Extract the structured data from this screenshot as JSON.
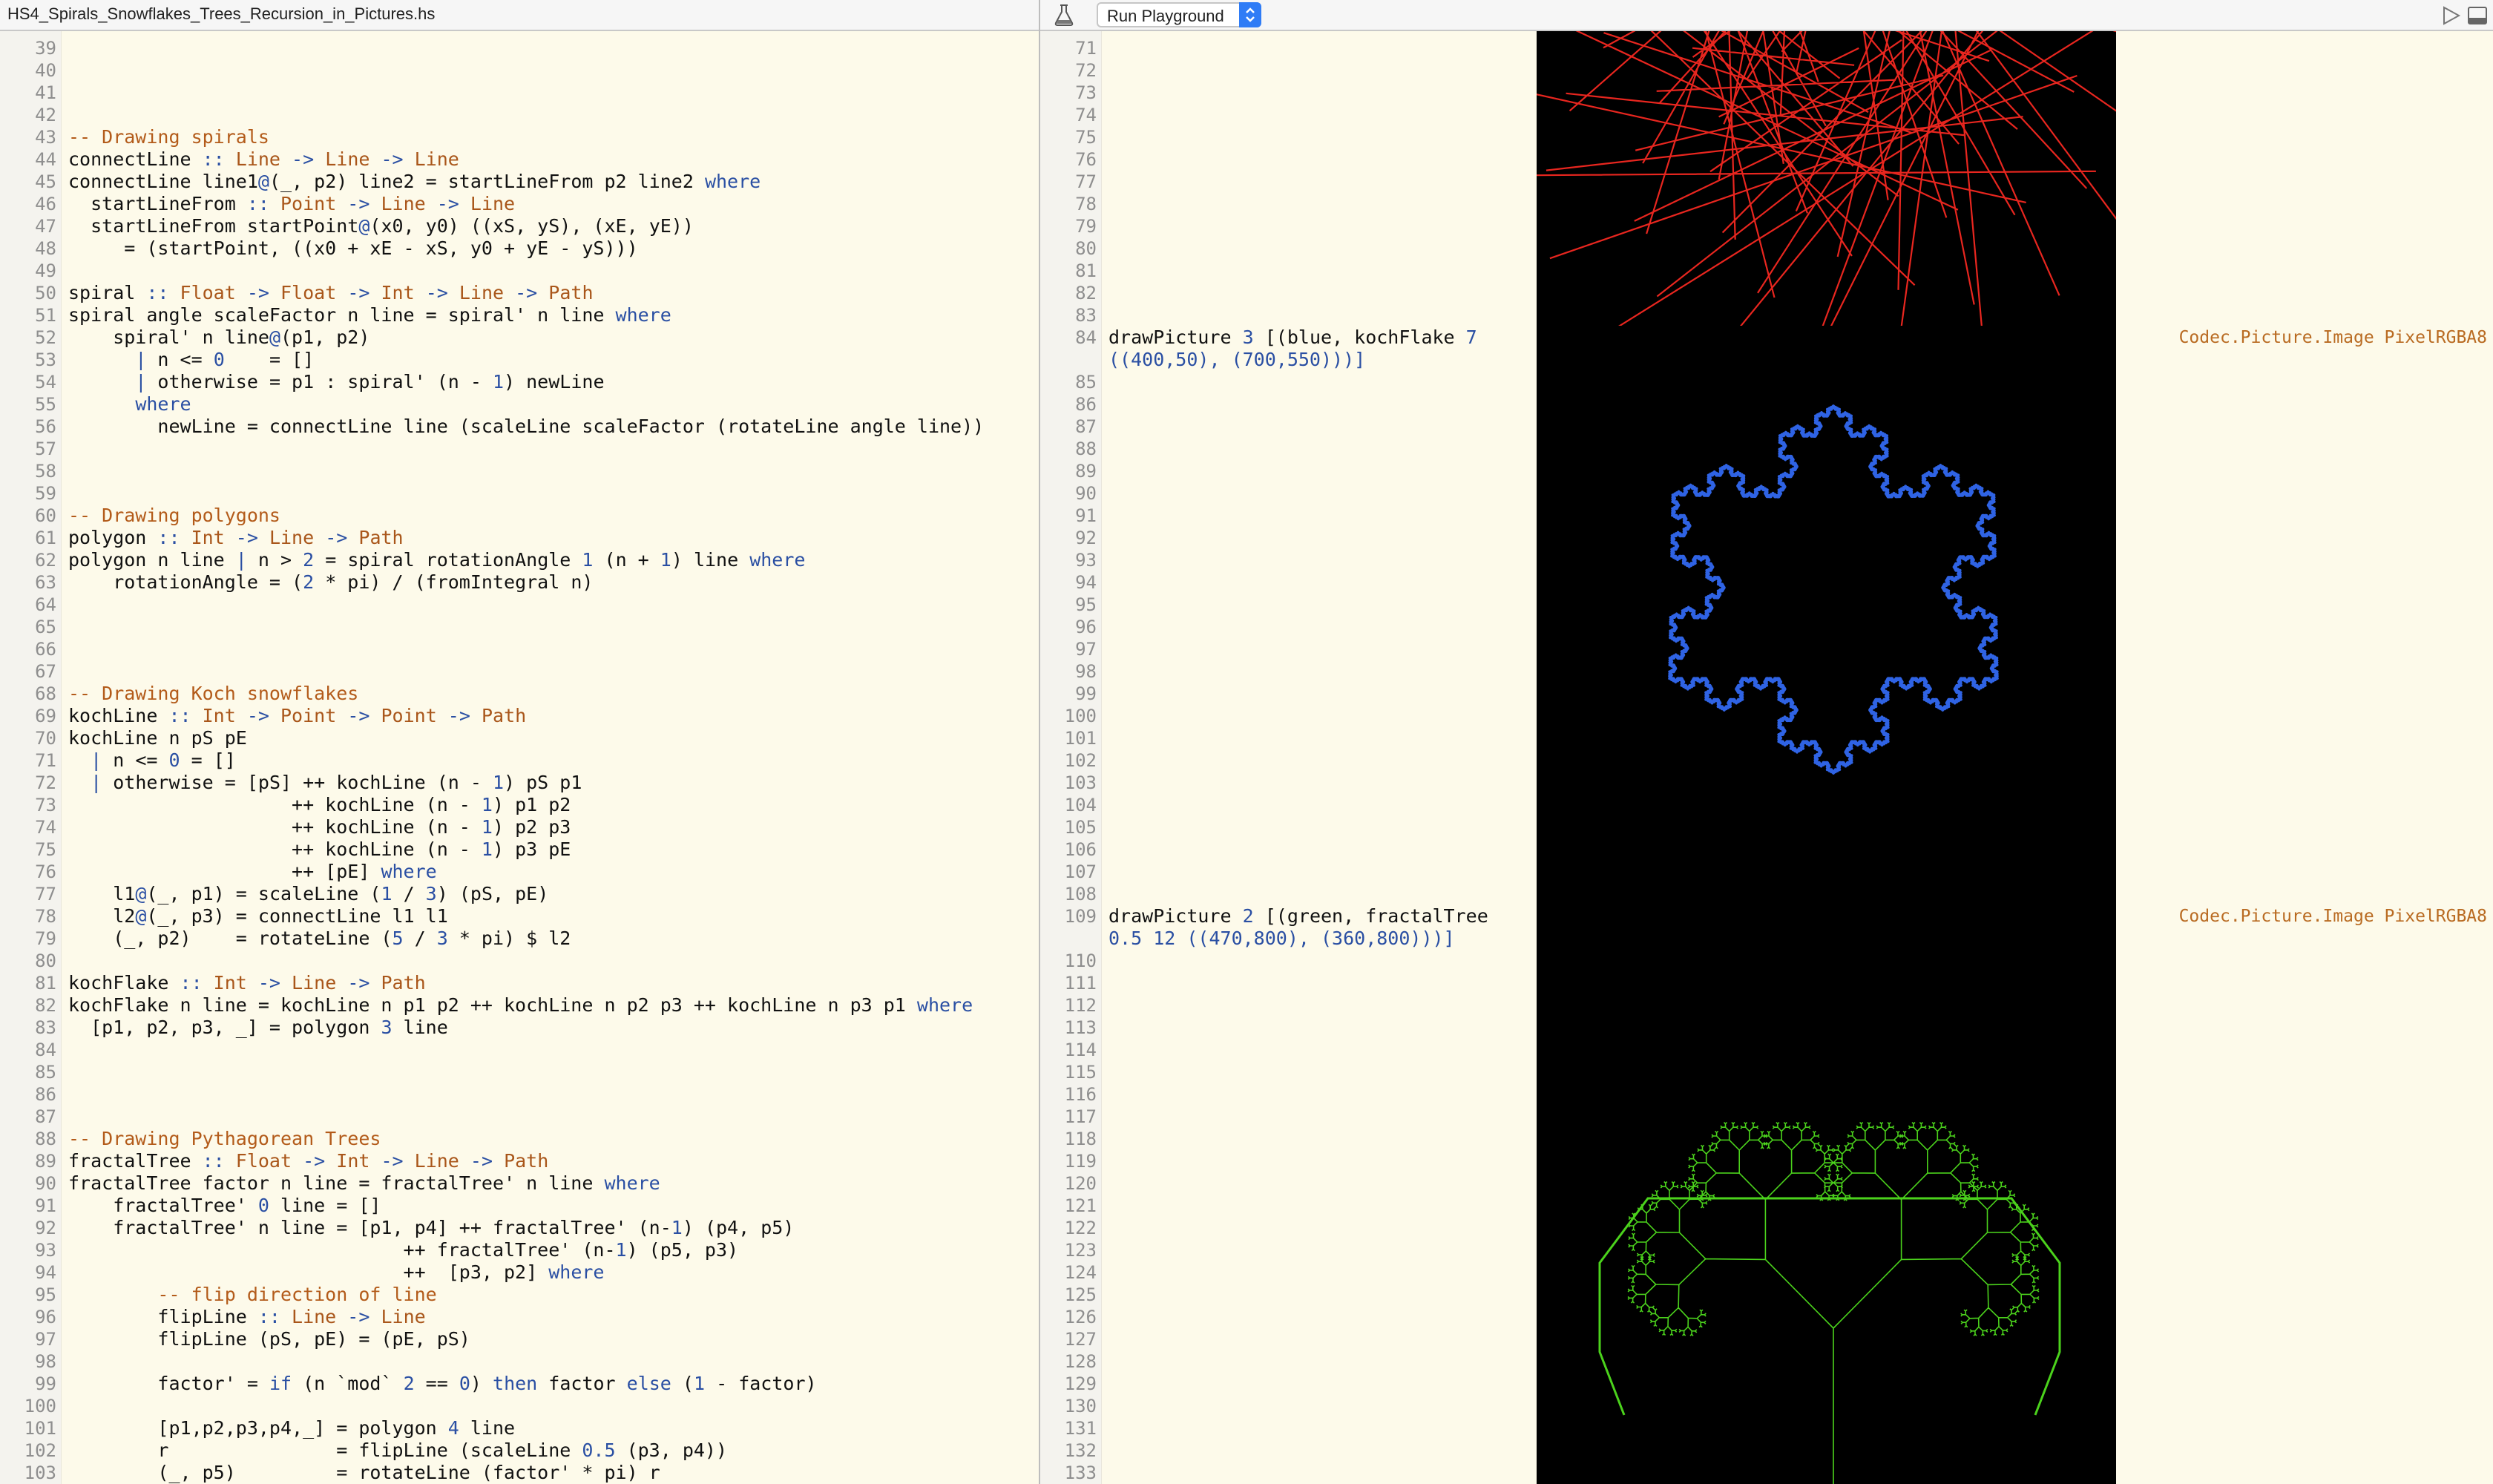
{
  "left_header": {
    "file_name": "HS4_Spirals_Snowflakes_Trees_Recursion_in_Pictures.hs"
  },
  "right_header": {
    "run_label": "Run Playground",
    "icons": [
      "flask-icon",
      "chevron-updown-icon",
      "play-icon",
      "panel-toggle-icon"
    ]
  },
  "left_lines": [
    {
      "n": "39",
      "t": []
    },
    {
      "n": "40",
      "t": []
    },
    {
      "n": "41",
      "t": []
    },
    {
      "n": "42",
      "t": []
    },
    {
      "n": "43",
      "t": [
        [
          "-- Drawing spirals",
          "cm"
        ]
      ]
    },
    {
      "n": "44",
      "t": [
        [
          "connectLine ",
          ""
        ],
        [
          ":: ",
          "op"
        ],
        [
          "Line",
          "ty"
        ],
        [
          " -> ",
          "op"
        ],
        [
          "Line",
          "ty"
        ],
        [
          " -> ",
          "op"
        ],
        [
          "Line",
          "ty"
        ]
      ]
    },
    {
      "n": "45",
      "t": [
        [
          "connectLine line1",
          ""
        ],
        [
          "@",
          "op"
        ],
        [
          "(_, p2) line2 = startLineFrom p2 line2 ",
          ""
        ],
        [
          "where",
          "kw"
        ]
      ]
    },
    {
      "n": "46",
      "t": [
        [
          "  startLineFrom ",
          ""
        ],
        [
          ":: ",
          "op"
        ],
        [
          "Point",
          "ty"
        ],
        [
          " -> ",
          "op"
        ],
        [
          "Line",
          "ty"
        ],
        [
          " -> ",
          "op"
        ],
        [
          "Line",
          "ty"
        ]
      ]
    },
    {
      "n": "47",
      "t": [
        [
          "  startLineFrom startPoint",
          ""
        ],
        [
          "@",
          "op"
        ],
        [
          "(x0, y0) ((xS, yS), (xE, yE))",
          ""
        ]
      ]
    },
    {
      "n": "48",
      "t": [
        [
          "     = (startPoint, ((x0 + xE - xS, y0 + yE - yS)))",
          ""
        ]
      ]
    },
    {
      "n": "49",
      "t": []
    },
    {
      "n": "50",
      "t": [
        [
          "spiral ",
          ""
        ],
        [
          ":: ",
          "op"
        ],
        [
          "Float",
          "ty"
        ],
        [
          " -> ",
          "op"
        ],
        [
          "Float",
          "ty"
        ],
        [
          " -> ",
          "op"
        ],
        [
          "Int",
          "ty"
        ],
        [
          " -> ",
          "op"
        ],
        [
          "Line",
          "ty"
        ],
        [
          " -> ",
          "op"
        ],
        [
          "Path",
          "ty"
        ]
      ]
    },
    {
      "n": "51",
      "t": [
        [
          "spiral angle scaleFactor n line = spiral' n line ",
          ""
        ],
        [
          "where",
          "kw"
        ]
      ]
    },
    {
      "n": "52",
      "t": [
        [
          "    spiral' n line",
          ""
        ],
        [
          "@",
          "op"
        ],
        [
          "(p1, p2)",
          ""
        ]
      ]
    },
    {
      "n": "53",
      "t": [
        [
          "      ",
          ""
        ],
        [
          "|",
          "op"
        ],
        [
          " n <= ",
          ""
        ],
        [
          "0",
          "num"
        ],
        [
          "    = []",
          ""
        ]
      ]
    },
    {
      "n": "54",
      "t": [
        [
          "      ",
          ""
        ],
        [
          "|",
          "op"
        ],
        [
          " otherwise = p1 : spiral' (n - ",
          ""
        ],
        [
          "1",
          "num"
        ],
        [
          ") newLine",
          ""
        ]
      ]
    },
    {
      "n": "55",
      "t": [
        [
          "      ",
          ""
        ],
        [
          "where",
          "kw"
        ]
      ]
    },
    {
      "n": "56",
      "t": [
        [
          "        newLine = connectLine line (scaleLine scaleFactor (rotateLine angle line))",
          ""
        ]
      ]
    },
    {
      "n": "57",
      "t": []
    },
    {
      "n": "58",
      "t": []
    },
    {
      "n": "59",
      "t": []
    },
    {
      "n": "60",
      "t": [
        [
          "-- Drawing polygons",
          "cm"
        ]
      ]
    },
    {
      "n": "61",
      "t": [
        [
          "polygon ",
          ""
        ],
        [
          ":: ",
          "op"
        ],
        [
          "Int",
          "ty"
        ],
        [
          " -> ",
          "op"
        ],
        [
          "Line",
          "ty"
        ],
        [
          " -> ",
          "op"
        ],
        [
          "Path",
          "ty"
        ]
      ]
    },
    {
      "n": "62",
      "t": [
        [
          "polygon n line ",
          ""
        ],
        [
          "|",
          "op"
        ],
        [
          " n > ",
          ""
        ],
        [
          "2",
          "num"
        ],
        [
          " = spiral rotationAngle ",
          ""
        ],
        [
          "1",
          "num"
        ],
        [
          " (n + ",
          ""
        ],
        [
          "1",
          "num"
        ],
        [
          ") line ",
          ""
        ],
        [
          "where",
          "kw"
        ]
      ]
    },
    {
      "n": "63",
      "t": [
        [
          "    rotationAngle = (",
          ""
        ],
        [
          "2",
          "num"
        ],
        [
          " * pi) / (fromIntegral n)",
          ""
        ]
      ]
    },
    {
      "n": "64",
      "t": []
    },
    {
      "n": "65",
      "t": []
    },
    {
      "n": "66",
      "t": []
    },
    {
      "n": "67",
      "t": []
    },
    {
      "n": "68",
      "t": [
        [
          "-- Drawing Koch snowflakes",
          "cm"
        ]
      ]
    },
    {
      "n": "69",
      "t": [
        [
          "kochLine ",
          ""
        ],
        [
          ":: ",
          "op"
        ],
        [
          "Int",
          "ty"
        ],
        [
          " -> ",
          "op"
        ],
        [
          "Point",
          "ty"
        ],
        [
          " -> ",
          "op"
        ],
        [
          "Point",
          "ty"
        ],
        [
          " -> ",
          "op"
        ],
        [
          "Path",
          "ty"
        ]
      ]
    },
    {
      "n": "70",
      "t": [
        [
          "kochLine n pS pE",
          ""
        ]
      ]
    },
    {
      "n": "71",
      "t": [
        [
          "  ",
          ""
        ],
        [
          "|",
          "op"
        ],
        [
          " n <= ",
          ""
        ],
        [
          "0",
          "num"
        ],
        [
          " = []",
          ""
        ]
      ]
    },
    {
      "n": "72",
      "t": [
        [
          "  ",
          ""
        ],
        [
          "|",
          "op"
        ],
        [
          " otherwise = [pS] ++ kochLine (n - ",
          ""
        ],
        [
          "1",
          "num"
        ],
        [
          ") pS p1",
          ""
        ]
      ]
    },
    {
      "n": "73",
      "t": [
        [
          "                    ++ kochLine (n - ",
          ""
        ],
        [
          "1",
          "num"
        ],
        [
          ") p1 p2",
          ""
        ]
      ]
    },
    {
      "n": "74",
      "t": [
        [
          "                    ++ kochLine (n - ",
          ""
        ],
        [
          "1",
          "num"
        ],
        [
          ") p2 p3",
          ""
        ]
      ]
    },
    {
      "n": "75",
      "t": [
        [
          "                    ++ kochLine (n - ",
          ""
        ],
        [
          "1",
          "num"
        ],
        [
          ") p3 pE",
          ""
        ]
      ]
    },
    {
      "n": "76",
      "t": [
        [
          "                    ++ [pE] ",
          ""
        ],
        [
          "where",
          "kw"
        ]
      ]
    },
    {
      "n": "77",
      "t": [
        [
          "    l1",
          ""
        ],
        [
          "@",
          "op"
        ],
        [
          "(_, p1) = scaleLine (",
          ""
        ],
        [
          "1",
          "num"
        ],
        [
          " / ",
          ""
        ],
        [
          "3",
          "num"
        ],
        [
          ") (pS, pE)",
          ""
        ]
      ]
    },
    {
      "n": "78",
      "t": [
        [
          "    l2",
          ""
        ],
        [
          "@",
          "op"
        ],
        [
          "(_, p3) = connectLine l1 l1",
          ""
        ]
      ]
    },
    {
      "n": "79",
      "t": [
        [
          "    (_, p2)    = rotateLine (",
          ""
        ],
        [
          "5",
          "num"
        ],
        [
          " / ",
          ""
        ],
        [
          "3",
          "num"
        ],
        [
          " * pi) $ l2",
          ""
        ]
      ]
    },
    {
      "n": "80",
      "t": []
    },
    {
      "n": "81",
      "t": [
        [
          "kochFlake ",
          ""
        ],
        [
          ":: ",
          "op"
        ],
        [
          "Int",
          "ty"
        ],
        [
          " -> ",
          "op"
        ],
        [
          "Line",
          "ty"
        ],
        [
          " -> ",
          "op"
        ],
        [
          "Path",
          "ty"
        ]
      ]
    },
    {
      "n": "82",
      "t": [
        [
          "kochFlake n line = kochLine n p1 p2 ++ kochLine n p2 p3 ++ kochLine n p3 p1 ",
          ""
        ],
        [
          "where",
          "kw"
        ]
      ]
    },
    {
      "n": "83",
      "t": [
        [
          "  [p1, p2, p3, _] = polygon ",
          ""
        ],
        [
          "3",
          "num"
        ],
        [
          " line",
          ""
        ]
      ]
    },
    {
      "n": "84",
      "t": []
    },
    {
      "n": "85",
      "t": []
    },
    {
      "n": "86",
      "t": []
    },
    {
      "n": "87",
      "t": []
    },
    {
      "n": "88",
      "t": [
        [
          "-- Drawing Pythagorean Trees",
          "cm"
        ]
      ]
    },
    {
      "n": "89",
      "t": [
        [
          "fractalTree ",
          ""
        ],
        [
          ":: ",
          "op"
        ],
        [
          "Float",
          "ty"
        ],
        [
          " -> ",
          "op"
        ],
        [
          "Int",
          "ty"
        ],
        [
          " -> ",
          "op"
        ],
        [
          "Line",
          "ty"
        ],
        [
          " -> ",
          "op"
        ],
        [
          "Path",
          "ty"
        ]
      ]
    },
    {
      "n": "90",
      "t": [
        [
          "fractalTree factor n line = fractalTree' n line ",
          ""
        ],
        [
          "where",
          "kw"
        ]
      ]
    },
    {
      "n": "91",
      "t": [
        [
          "    fractalTree' ",
          ""
        ],
        [
          "0",
          "num"
        ],
        [
          " line = []",
          ""
        ]
      ]
    },
    {
      "n": "92",
      "t": [
        [
          "    fractalTree' n line = [p1, p4] ++ fractalTree' (n-",
          ""
        ],
        [
          "1",
          "num"
        ],
        [
          ") (p4, p5)",
          ""
        ]
      ]
    },
    {
      "n": "93",
      "t": [
        [
          "                              ++ fractalTree' (n-",
          ""
        ],
        [
          "1",
          "num"
        ],
        [
          ") (p5, p3)",
          ""
        ]
      ]
    },
    {
      "n": "94",
      "t": [
        [
          "                              ++  [p3, p2] ",
          ""
        ],
        [
          "where",
          "kw"
        ]
      ]
    },
    {
      "n": "95",
      "t": [
        [
          "        -- flip direction of line",
          "cm"
        ]
      ]
    },
    {
      "n": "96",
      "t": [
        [
          "        flipLine ",
          ""
        ],
        [
          ":: ",
          "op"
        ],
        [
          "Line",
          "ty"
        ],
        [
          " -> ",
          "op"
        ],
        [
          "Line",
          "ty"
        ]
      ]
    },
    {
      "n": "97",
      "t": [
        [
          "        flipLine (pS, pE) = (pE, pS)",
          ""
        ]
      ]
    },
    {
      "n": "98",
      "t": []
    },
    {
      "n": "99",
      "t": [
        [
          "        factor' = ",
          ""
        ],
        [
          "if",
          "kw"
        ],
        [
          " (n `mod` ",
          ""
        ],
        [
          "2",
          "num"
        ],
        [
          " == ",
          ""
        ],
        [
          "0",
          "num"
        ],
        [
          ") ",
          ""
        ],
        [
          "then",
          "kw"
        ],
        [
          " factor ",
          ""
        ],
        [
          "else",
          "kw"
        ],
        [
          " (",
          ""
        ],
        [
          "1",
          "num"
        ],
        [
          " - factor)",
          ""
        ]
      ]
    },
    {
      "n": "100",
      "t": []
    },
    {
      "n": "101",
      "t": [
        [
          "        [p1,p2,p3,p4,_] = polygon ",
          ""
        ],
        [
          "4",
          "num"
        ],
        [
          " line",
          ""
        ]
      ]
    },
    {
      "n": "102",
      "t": [
        [
          "        r               = flipLine (scaleLine ",
          ""
        ],
        [
          "0.5",
          "num"
        ],
        [
          " (p3, p4))",
          ""
        ]
      ]
    },
    {
      "n": "103",
      "t": [
        [
          "        (_, p5)         = rotateLine (factor' * pi) r",
          ""
        ]
      ]
    }
  ],
  "right_lines": [
    {
      "n": "71",
      "t": []
    },
    {
      "n": "72",
      "t": []
    },
    {
      "n": "73",
      "t": []
    },
    {
      "n": "74",
      "t": []
    },
    {
      "n": "75",
      "t": []
    },
    {
      "n": "76",
      "t": []
    },
    {
      "n": "77",
      "t": []
    },
    {
      "n": "78",
      "t": []
    },
    {
      "n": "79",
      "t": []
    },
    {
      "n": "80",
      "t": []
    },
    {
      "n": "81",
      "t": []
    },
    {
      "n": "82",
      "t": []
    },
    {
      "n": "83",
      "t": []
    },
    {
      "n": "84",
      "t": [
        [
          "drawPicture ",
          ""
        ],
        [
          "3",
          "num"
        ],
        [
          " [(blue, kochFlake ",
          ""
        ],
        [
          "7",
          "num"
        ]
      ]
    },
    {
      "n": "",
      "t": [
        [
          "((400,50), (700,550)))]",
          "num"
        ]
      ]
    },
    {
      "n": "85",
      "t": []
    },
    {
      "n": "86",
      "t": []
    },
    {
      "n": "87",
      "t": []
    },
    {
      "n": "88",
      "t": []
    },
    {
      "n": "89",
      "t": []
    },
    {
      "n": "90",
      "t": []
    },
    {
      "n": "91",
      "t": []
    },
    {
      "n": "92",
      "t": []
    },
    {
      "n": "93",
      "t": []
    },
    {
      "n": "94",
      "t": []
    },
    {
      "n": "95",
      "t": []
    },
    {
      "n": "96",
      "t": []
    },
    {
      "n": "97",
      "t": []
    },
    {
      "n": "98",
      "t": []
    },
    {
      "n": "99",
      "t": []
    },
    {
      "n": "100",
      "t": []
    },
    {
      "n": "101",
      "t": []
    },
    {
      "n": "102",
      "t": []
    },
    {
      "n": "103",
      "t": []
    },
    {
      "n": "104",
      "t": []
    },
    {
      "n": "105",
      "t": []
    },
    {
      "n": "106",
      "t": []
    },
    {
      "n": "107",
      "t": []
    },
    {
      "n": "108",
      "t": []
    },
    {
      "n": "109",
      "t": [
        [
          "drawPicture ",
          ""
        ],
        [
          "2",
          "num"
        ],
        [
          " [(green, fractalTree",
          ""
        ]
      ]
    },
    {
      "n": "",
      "t": [
        [
          "0.5",
          "num"
        ],
        [
          " ",
          ""
        ],
        [
          "12",
          "num"
        ],
        [
          " ((470,800), (360,800)))]",
          "num"
        ]
      ]
    },
    {
      "n": "110",
      "t": []
    },
    {
      "n": "111",
      "t": []
    },
    {
      "n": "112",
      "t": []
    },
    {
      "n": "113",
      "t": []
    },
    {
      "n": "114",
      "t": []
    },
    {
      "n": "115",
      "t": []
    },
    {
      "n": "116",
      "t": []
    },
    {
      "n": "117",
      "t": []
    },
    {
      "n": "118",
      "t": []
    },
    {
      "n": "119",
      "t": []
    },
    {
      "n": "120",
      "t": []
    },
    {
      "n": "121",
      "t": []
    },
    {
      "n": "122",
      "t": []
    },
    {
      "n": "123",
      "t": []
    },
    {
      "n": "124",
      "t": []
    },
    {
      "n": "125",
      "t": []
    },
    {
      "n": "126",
      "t": []
    },
    {
      "n": "127",
      "t": []
    },
    {
      "n": "128",
      "t": []
    },
    {
      "n": "129",
      "t": []
    },
    {
      "n": "130",
      "t": []
    },
    {
      "n": "131",
      "t": []
    },
    {
      "n": "132",
      "t": []
    },
    {
      "n": "133",
      "t": []
    }
  ],
  "results": [
    {
      "line": "84",
      "text": "Codec.Picture.Image PixelRGBA8"
    },
    {
      "line": "109",
      "text": "Codec.Picture.Image PixelRGBA8"
    }
  ],
  "colors": {
    "editor_bg": "#fdfaea",
    "keyword": "#2a4fa3",
    "type": "#a9561a",
    "comment": "#b35b1a",
    "spiral": "#e8261f",
    "koch": "#2f63e4",
    "tree": "#4bd21c",
    "canvas_bg": "#000000",
    "run_button": "#2f7cf6"
  }
}
